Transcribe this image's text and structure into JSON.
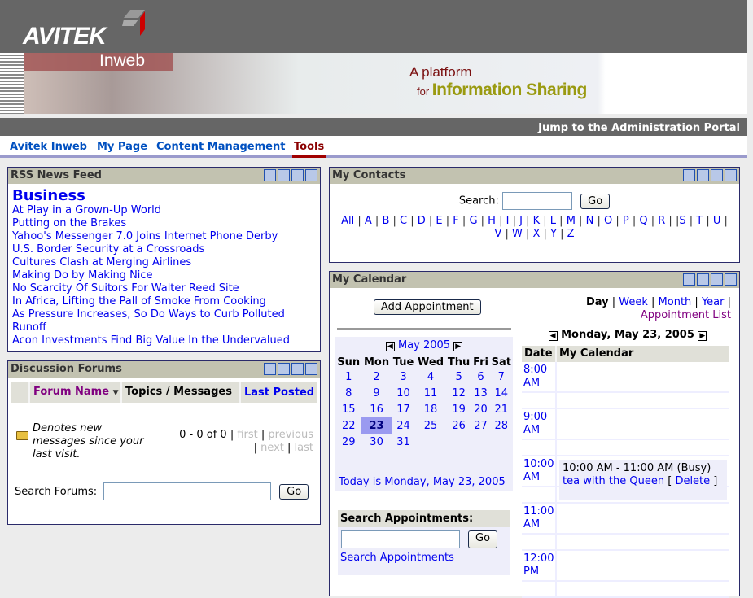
{
  "header": {
    "logo": "AVITEK",
    "product": "Inweb",
    "tagline_1": "A platform",
    "tagline_for": "for",
    "tagline_2": "Information Sharing",
    "admin_link": "Jump to the Administration Portal"
  },
  "nav": {
    "items": [
      {
        "label": "Avitek Inweb"
      },
      {
        "label": "My Page"
      },
      {
        "label": "Content Management"
      },
      {
        "label": "Tools",
        "active": true
      }
    ]
  },
  "rss": {
    "title": "RSS News Feed",
    "category": "Business",
    "items": [
      "At Play in a Grown-Up World",
      "Putting on the Brakes",
      "Yahoo's Messenger 7.0 Joins Internet Phone Derby",
      "U.S. Border Security at a Crossroads",
      "Cultures Clash at Merging Airlines",
      "Making Do by Making Nice",
      "No Scarcity Of Suitors For Walter Reed Site",
      "In Africa, Lifting the Pall of Smoke From Cooking",
      "As Pressure Increases, So Do Ways to Curb Polluted Runoff",
      "Acon Investments Find Big Value In the Undervalued"
    ]
  },
  "forums": {
    "title": "Discussion Forums",
    "col_forum": "Forum Name",
    "col_topics": "Topics / Messages",
    "col_last": "Last Posted",
    "legend": "Denotes new messages since your last visit.",
    "count": "0 - 0 of 0",
    "first": "first",
    "previous": "previous",
    "next": "next",
    "last": "last",
    "search_label": "Search Forums:",
    "go": "Go"
  },
  "contacts": {
    "title": "My Contacts",
    "search_label": "Search:",
    "go": "Go",
    "letters": [
      "All",
      "A",
      "B",
      "C",
      "D",
      "E",
      "F",
      "G",
      "H",
      "I",
      "J",
      "K",
      "L",
      "M",
      "N",
      "O",
      "P",
      "Q",
      "R",
      "S",
      "T",
      "U",
      "V",
      "W",
      "X",
      "Y",
      "Z"
    ]
  },
  "calendar": {
    "title": "My Calendar",
    "add": "Add Appointment",
    "views": {
      "day": "Day",
      "week": "Week",
      "month": "Month",
      "year": "Year",
      "list": "Appointment List"
    },
    "month_label": "May 2005",
    "weekdays": [
      "Sun",
      "Mon",
      "Tue",
      "Wed",
      "Thu",
      "Fri",
      "Sat"
    ],
    "selected_day": 23,
    "today": "Today is Monday, May 23, 2005",
    "day_title": "Monday, May 23, 2005",
    "col_date": "Date",
    "col_cal": "My Calendar",
    "hours": [
      "8:00 AM",
      "9:00 AM",
      "10:00 AM",
      "11:00 AM",
      "12:00 PM"
    ],
    "event_time": "10:00 AM - 11:00 AM (Busy)",
    "event_name": "tea with the Queen",
    "delete": "Delete",
    "search_title": "Search Appointments:",
    "search_go": "Go",
    "search_link": "Search Appointments"
  },
  "colors": {
    "header_gray": "#666666",
    "title_bar": "#c2c2b0",
    "link": "#0000ee",
    "active_tab": "#8b0000",
    "selected_day": "#9a9af0"
  }
}
